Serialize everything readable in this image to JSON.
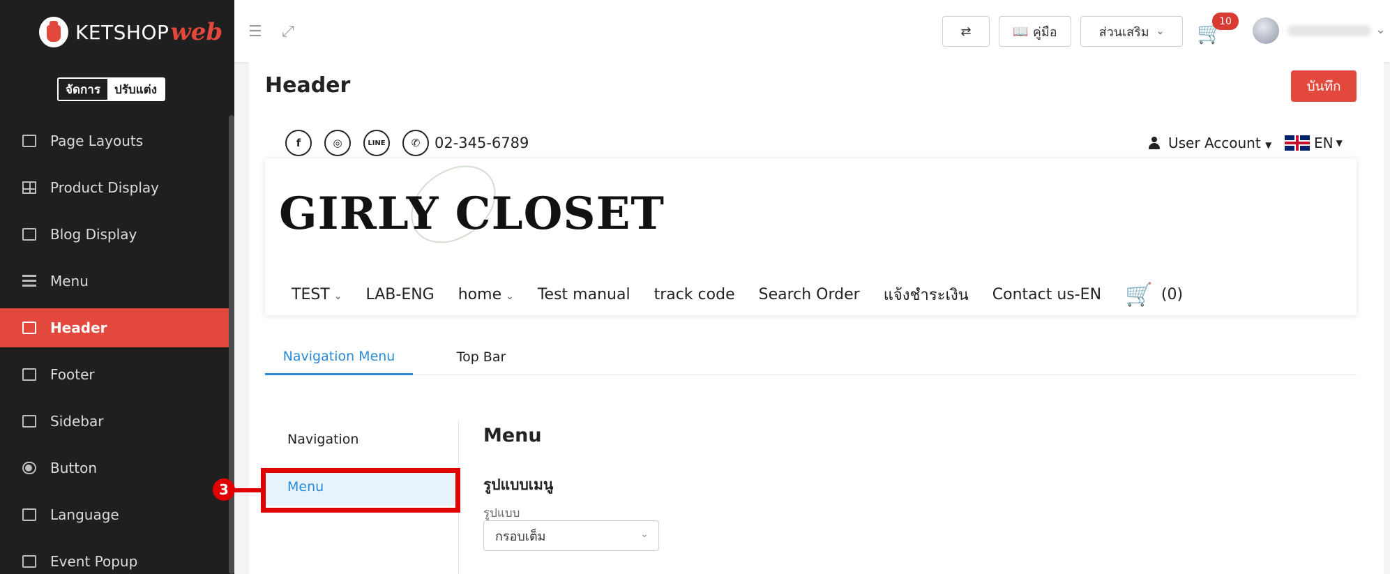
{
  "brand": {
    "left": "KETSHOP",
    "right": "web"
  },
  "mode": {
    "manage": "จัดการ",
    "customize": "ปรับแต่ง"
  },
  "sidebar": {
    "items": [
      {
        "label": "Page Layouts",
        "icon": "layout-icon"
      },
      {
        "label": "Product Display",
        "icon": "grid-icon"
      },
      {
        "label": "Blog Display",
        "icon": "list-icon"
      },
      {
        "label": "Menu",
        "icon": "menu-icon"
      },
      {
        "label": "Header",
        "icon": "header-icon",
        "active": true
      },
      {
        "label": "Footer",
        "icon": "footer-icon"
      },
      {
        "label": "Sidebar",
        "icon": "sidebar-icon"
      },
      {
        "label": "Button",
        "icon": "toggle-icon"
      },
      {
        "label": "Language",
        "icon": "language-icon"
      },
      {
        "label": "Event Popup",
        "icon": "popup-icon"
      }
    ]
  },
  "topbar": {
    "manual_label": "คู่มือ",
    "addons_label": "ส่วนเสริม",
    "cart_count": "10"
  },
  "page": {
    "title": "Header",
    "save_label": "บันทึก"
  },
  "preview": {
    "phone": "02-345-6789",
    "user_account": "User Account",
    "language": "EN",
    "logo_text": "GIRLY CLOSET",
    "social": {
      "facebook": "f",
      "line": "LINE"
    },
    "menu": [
      {
        "label": "TEST",
        "dropdown": true
      },
      {
        "label": "LAB-ENG",
        "dropdown": false
      },
      {
        "label": "home",
        "dropdown": true
      },
      {
        "label": "Test manual",
        "dropdown": false
      },
      {
        "label": "track code",
        "dropdown": false
      },
      {
        "label": "Search Order",
        "dropdown": false
      },
      {
        "label": "แจ้งชำระเงิน",
        "dropdown": false
      },
      {
        "label": "Contact us-EN",
        "dropdown": false
      }
    ],
    "cart": "(0)"
  },
  "tabs": {
    "nav_menu": "Navigation Menu",
    "top_bar": "Top Bar"
  },
  "settings": {
    "nav_items": [
      "Navigation",
      "Menu"
    ],
    "section_title": "Menu",
    "subsection": "รูปแบบเมนู",
    "field_label": "รูปแบบ",
    "select_value": "กรอบเต็ม"
  },
  "annotation": {
    "step": "3"
  },
  "colors": {
    "accent": "#e2483c",
    "link": "#2a8ad8",
    "sidebar_bg": "#1f1f1f"
  }
}
